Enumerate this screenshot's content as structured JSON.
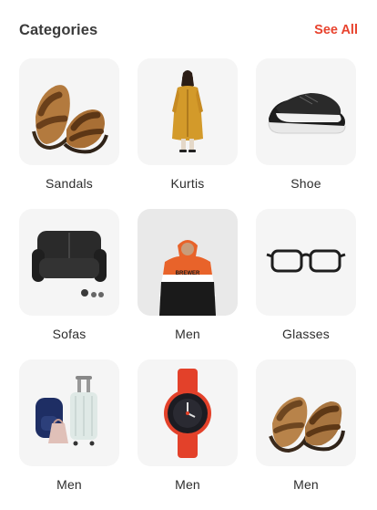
{
  "header": {
    "title": "Categories",
    "see_all_label": "See All"
  },
  "categories": [
    {
      "label": "Sandals",
      "icon": "sandals-icon"
    },
    {
      "label": "Kurtis",
      "icon": "kurti-icon"
    },
    {
      "label": "Shoe",
      "icon": "shoe-icon"
    },
    {
      "label": "Sofas",
      "icon": "sofa-icon"
    },
    {
      "label": "Men",
      "icon": "hoodie-icon"
    },
    {
      "label": "Glasses",
      "icon": "glasses-icon"
    },
    {
      "label": "Men",
      "icon": "luggage-icon"
    },
    {
      "label": "Men",
      "icon": "watch-icon"
    },
    {
      "label": "Men",
      "icon": "sandals-icon"
    }
  ],
  "colors": {
    "accent": "#e8432e",
    "tile_bg": "#f5f5f5"
  }
}
